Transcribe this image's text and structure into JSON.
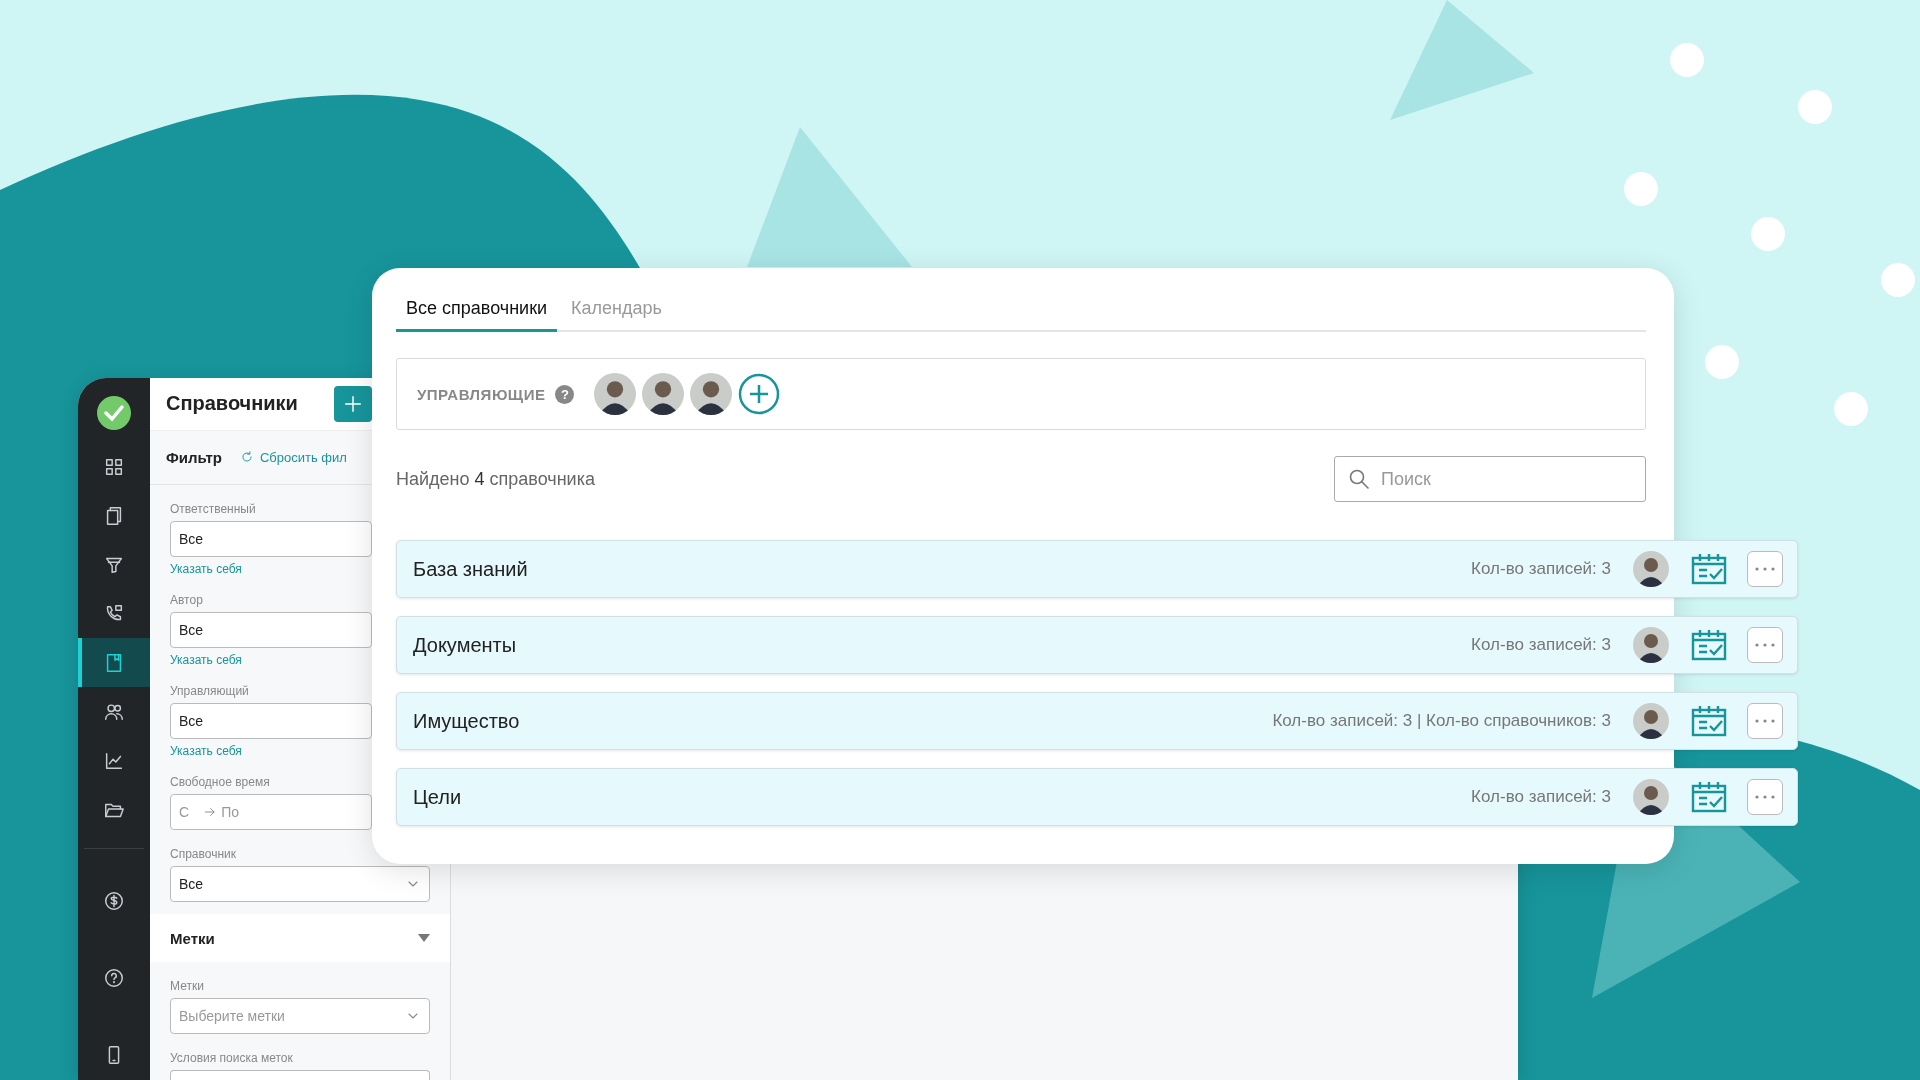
{
  "app_window": {
    "title": "Справочники",
    "filter_label": "Фильтр",
    "reset_link": "Сбросить фил",
    "sidebar": [
      {
        "selected": false
      },
      {
        "selected": false
      },
      {
        "selected": false
      },
      {
        "selected": false
      },
      {
        "selected": true
      },
      {
        "selected": false
      },
      {
        "selected": false
      },
      {
        "selected": false
      },
      {
        "selected": false
      },
      {
        "selected": false
      },
      {
        "selected": false
      }
    ],
    "filters": [
      {
        "kind": "person",
        "label": "Ответственный",
        "value": "Все",
        "link": "Указать себя"
      },
      {
        "kind": "person",
        "label": "Автор",
        "value": "Все",
        "link": "Указать себя"
      },
      {
        "kind": "person",
        "label": "Управляющий",
        "value": "Все",
        "link": "Указать себя"
      },
      {
        "kind": "range",
        "label": "Свободное время",
        "from_placeholder": "С",
        "to_placeholder": "По"
      },
      {
        "kind": "dropdown",
        "label": "Справочник",
        "value": "Все"
      }
    ],
    "tags_section": {
      "title": "Метки",
      "expanded": true,
      "fields": [
        {
          "label": "Метки",
          "placeholder": "Выберите метки"
        },
        {
          "label": "Условия поиска меток"
        }
      ]
    }
  },
  "main_card": {
    "tabs": [
      {
        "label": "Все справочники",
        "selected": true
      },
      {
        "label": "Календарь",
        "selected": false
      }
    ],
    "managers": {
      "label": "УПРАВЛЯЮЩИЕ",
      "help": "?"
    },
    "found_text": "Найдено **4** справочника",
    "search": {
      "placeholder": "Поиск"
    },
    "directories": [
      {
        "name": "База знаний",
        "stats": "Кол-во записей: 3"
      },
      {
        "name": "Документы",
        "stats": "Кол-во записей: 3"
      },
      {
        "name": "Имущество",
        "stats": "Кол-во записей: 3 | Кол-во справочников: 3"
      },
      {
        "name": "Цели",
        "stats": "Кол-во записей: 3"
      }
    ]
  }
}
